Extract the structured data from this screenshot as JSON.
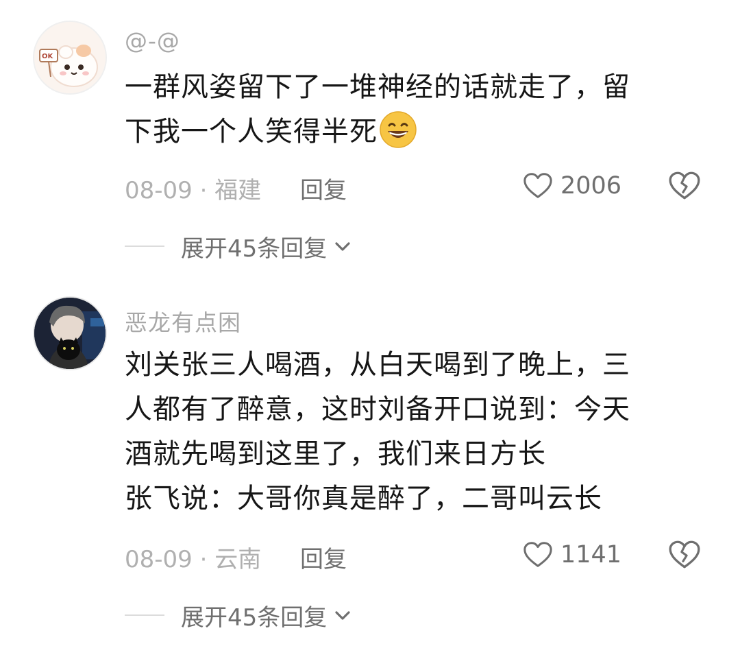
{
  "comments": [
    {
      "username": "@-@",
      "avatar": "cartoon-cat-holding-ok-sign",
      "lines": [
        "一群风姿留下了一堆神经的话就走了，留",
        "下我一个人笑得半死"
      ],
      "emoji": "grinning-face-emoji",
      "date": "08-09 · 福建",
      "reply_label": "回复",
      "likes": "2006",
      "expand_label": "展开45条回复"
    },
    {
      "username": "恶龙有点困",
      "avatar": "person-holding-black-cat",
      "lines": [
        "刘关张三人喝酒，从白天喝到了晚上，三",
        "人都有了醉意，这时刘备开口说到：今天",
        "酒就先喝到这里了，我们来日方长",
        "张飞说：大哥你真是醉了，二哥叫云长"
      ],
      "date": "08-09 · 云南",
      "reply_label": "回复",
      "likes": "1141",
      "expand_label": "展开45条回复"
    }
  ],
  "colors": {
    "username": "#a8a8a8",
    "content": "#161616",
    "meta": "#b0b0b0",
    "action": "#6f6f6f",
    "emoji": "#f7c544"
  }
}
